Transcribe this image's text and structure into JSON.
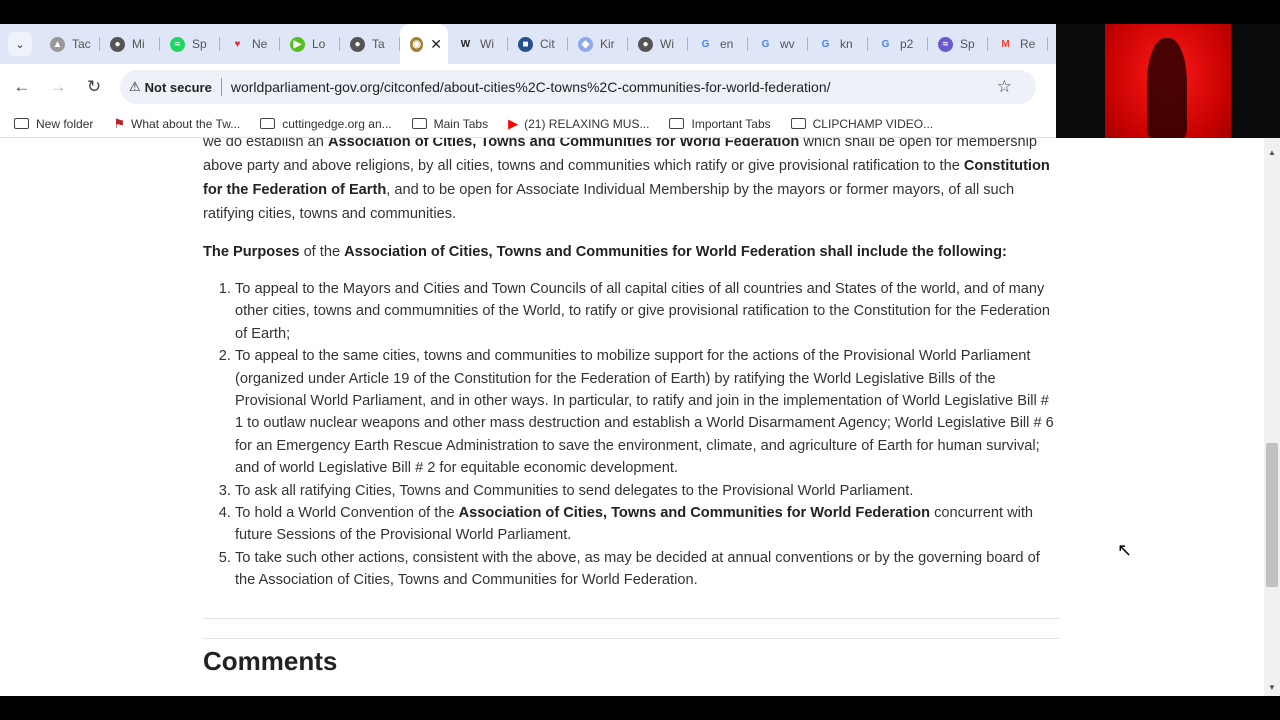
{
  "browser": {
    "tabs": [
      {
        "label": "Tac",
        "icon": "cat-icon",
        "color": "#999"
      },
      {
        "label": "Mi",
        "icon": "globe-icon",
        "color": "#555"
      },
      {
        "label": "Sp",
        "icon": "spotify-icon",
        "color": "#1ed760"
      },
      {
        "label": "Ne",
        "icon": "heart-icon",
        "color": "#d33"
      },
      {
        "label": "Lo",
        "icon": "play-icon",
        "color": "#53c21e"
      },
      {
        "label": "Ta",
        "icon": "globe-icon",
        "color": "#555"
      },
      {
        "label": "",
        "icon": "world-parliament-icon",
        "color": "#a08030",
        "active": true
      },
      {
        "label": "Wi",
        "icon": "weebly-icon",
        "color": "#222"
      },
      {
        "label": "Cit",
        "icon": "gms-icon",
        "color": "#24508f"
      },
      {
        "label": "Kir",
        "icon": "shield-icon",
        "color": "#8fa8e8"
      },
      {
        "label": "Wi",
        "icon": "globe-icon",
        "color": "#555"
      },
      {
        "label": "en",
        "icon": "google-icon",
        "color": "#4285f4"
      },
      {
        "label": "wv",
        "icon": "google-icon",
        "color": "#4285f4"
      },
      {
        "label": "kn",
        "icon": "google-icon",
        "color": "#4285f4"
      },
      {
        "label": "p2",
        "icon": "google-icon",
        "color": "#4285f4"
      },
      {
        "label": "Sp",
        "icon": "spotify-icon",
        "color": "#6a5acd"
      },
      {
        "label": "Re",
        "icon": "gmail-icon",
        "color": "#ea4335"
      }
    ],
    "security": "Not secure",
    "url": "worldparliament-gov.org/citconfed/about-cities%2C-towns%2C-communities-for-world-federation/",
    "bookmarks": [
      {
        "label": "New folder",
        "type": "folder"
      },
      {
        "label": "What about the Tw...",
        "type": "flag"
      },
      {
        "label": "cuttingedge.org an...",
        "type": "folder"
      },
      {
        "label": "Main Tabs",
        "type": "folder"
      },
      {
        "label": "(21) RELAXING MUS...",
        "type": "youtube"
      },
      {
        "label": "Important Tabs",
        "type": "folder"
      },
      {
        "label": "CLIPCHAMP VIDEO...",
        "type": "folder"
      }
    ]
  },
  "article": {
    "intro_pre": "we do establish an ",
    "intro_bold": "Association of Cities, Towns and Communities for World Federation",
    "intro_mid": " which shall be open for membership above party and above religions, by all cities, towns and communities which ratify or give provisional ratification to the ",
    "intro_bold2": "Constitution for the Federation of Earth",
    "intro_end": ", and to be open for Associate Individual Membership by the mayors or former mayors, of all such ratifying cities, towns and communities.",
    "purposes_bold": "The Purposes",
    "purposes_mid": " of the ",
    "purposes_bold2": "Association of Cities, Towns and Communities for World Federation shall include the following:",
    "items": [
      "To appeal to the Mayors and Cities and Town Councils of all capital cities of all countries and States of the world, and of many other cities, towns and commumnities of the World, to ratify or give provisional ratification to the Constitution for the Federation of Earth;",
      "To appeal to the same cities, towns and communities to mobilize support for the actions of the Provisional World Parliament (organized under Article 19 of the Constitution for the Federation of Earth) by ratifying the World Legislative Bills of the Provisional World Parliament, and in other ways. In particular, to ratify and join in the implementation of World Legislative Bill # 1 to outlaw nuclear weapons and other mass destruction and establish a World Disarmament Agency; World Legislative Bill # 6 for an Emergency Earth Rescue Administration to save the environment, climate, and agriculture of Earth for human survival; and of world Legislative Bill # 2 for equitable economic development.",
      "To ask all ratifying Cities, Towns and Communities to send delegates to the Provisional World Parliament.",
      "",
      "To take such other actions, consistent with the above, as may be decided at annual conventions or by the governing board of the Association of Cities, Towns and Communities for World Federation."
    ],
    "item4_pre": "To hold a World Convention of the ",
    "item4_bold": "Association of Cities, Towns and Communities for World Federation",
    "item4_end": " concurrent with future Sessions of the Provisional World Parliament.",
    "comments_heading": "Comments"
  },
  "scrollbar": {
    "position_percent": 55
  }
}
